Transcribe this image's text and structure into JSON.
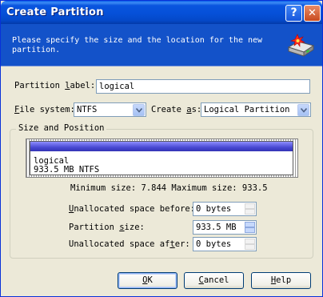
{
  "window": {
    "title": "Create Partition",
    "help_btn": "?",
    "close_btn": "✕"
  },
  "header": {
    "description": "Please specify the size and the location for the new partition."
  },
  "form": {
    "label_label_pre": "Partition ",
    "label_label_u": "l",
    "label_label_post": "abel:",
    "label_value": "logical",
    "fs_label_u": "F",
    "fs_label_post": "ile system:",
    "fs_value": "NTFS",
    "create_label_pre": "Create ",
    "create_label_u": "a",
    "create_label_post": "s:",
    "create_value": "Logical Partition"
  },
  "size_position": {
    "group_title": "Size and Position",
    "partition_name": "logical",
    "partition_info": "933.5 MB  NTFS",
    "min_max": "Minimum size: 7.844 Maximum size: 933.5",
    "unalloc_before_u": "U",
    "unalloc_before_post": "nallocated space before:",
    "unalloc_before_value": "0 bytes",
    "size_pre": "Partition ",
    "size_u": "s",
    "size_post": "ize:",
    "size_value": "933.5 MB",
    "unalloc_after_pre": "Unallocated space af",
    "unalloc_after_u": "t",
    "unalloc_after_post": "er:",
    "unalloc_after_value": "0 bytes"
  },
  "buttons": {
    "ok_u": "O",
    "ok_post": "K",
    "cancel_u": "C",
    "cancel_post": "ancel",
    "help_u": "H",
    "help_post": "elp"
  },
  "colors": {
    "titlebar": "#0a55df",
    "header": "#1352c9",
    "partition_bar": "#4848d2",
    "dialog_bg": "#ece9d8"
  }
}
